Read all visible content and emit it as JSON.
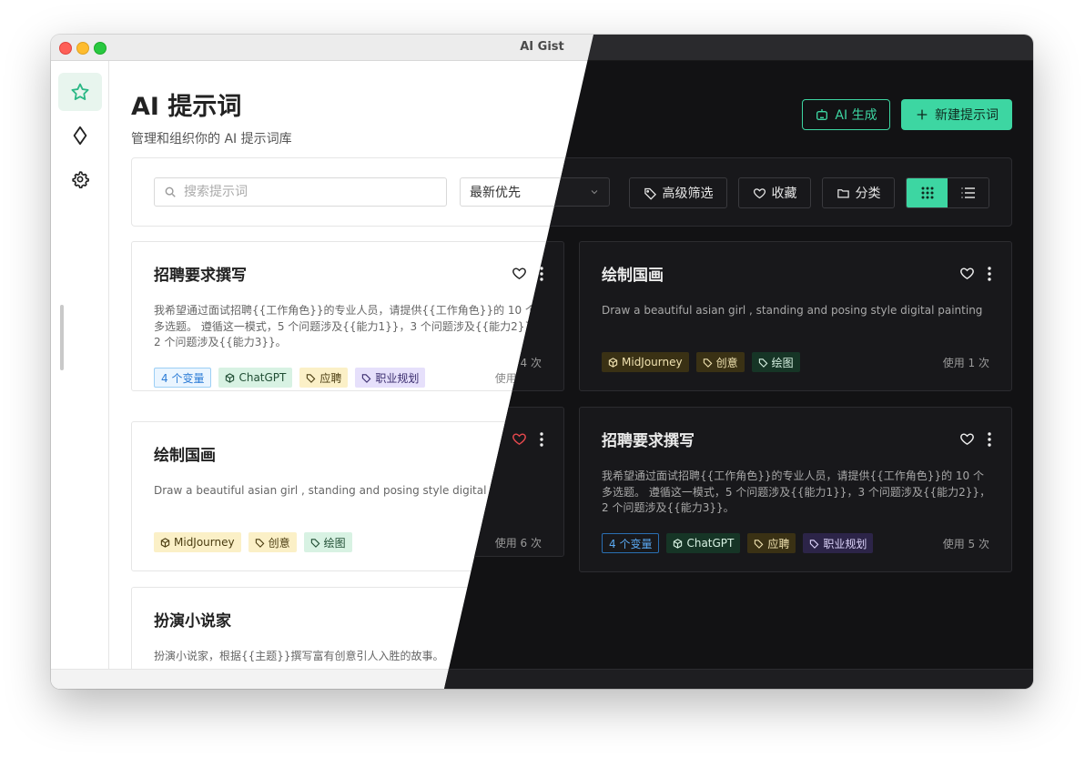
{
  "window": {
    "title": "AI Gist"
  },
  "sidebar": {
    "items": [
      {
        "icon": "star-icon",
        "active": true
      },
      {
        "icon": "diamond-icon",
        "active": false
      },
      {
        "icon": "gear-icon",
        "active": false
      }
    ]
  },
  "header": {
    "title": "AI 提示词",
    "subtitle": "管理和组织你的 AI 提示词库",
    "ai_button": "AI 生成",
    "new_button": "新建提示词"
  },
  "toolbar": {
    "search_placeholder": "搜索提示词",
    "sort_value": "最新优先",
    "filter_label": "高级筛选",
    "favorite_label": "收藏",
    "category_label": "分类"
  },
  "colors": {
    "accent": "#3dd6a2",
    "dark_bg": "#121214",
    "heart_active": "#e5484d"
  },
  "light_cards": [
    {
      "title": "招聘要求撰写",
      "desc": "我希望通过面试招聘{{工作角色}}的专业人员，请提供{{工作角色}}的 10 个多选题。 遵循这一模式，5 个问题涉及{{能力1}}，3 个问题涉及{{能力2}}，2 个问题涉及{{能力3}}。",
      "tags": [
        "4 个变量",
        "ChatGPT",
        "应聘",
        "职业规划"
      ],
      "usage": "使用 4 次"
    },
    {
      "title": "绘制国画",
      "desc": "Draw a beautiful asian girl , standing and posing style digital painting",
      "tags": [
        "MidJourney",
        "创意",
        "绘图"
      ],
      "usage": "使用 6 次"
    },
    {
      "title": "扮演小说家",
      "desc": "扮演小说家，根据{{主题}}撰写富有创意引人入胜的故事。"
    }
  ],
  "dark_cards": [
    {
      "title": "绘制国画",
      "desc": "Draw a beautiful asian girl , standing and posing style digital painting",
      "tags": [
        "MidJourney",
        "创意",
        "绘图"
      ],
      "usage": "使用 1 次"
    },
    {
      "title": "招聘要求撰写",
      "desc": "我希望通过面试招聘{{工作角色}}的专业人员，请提供{{工作角色}}的 10 个多选题。 遵循这一模式，5 个问题涉及{{能力1}}，3 个问题涉及{{能力2}}，2 个问题涉及{{能力3}}。",
      "tags": [
        "4 个变量",
        "ChatGPT",
        "应聘",
        "职业规划"
      ],
      "usage": "使用 5 次"
    }
  ]
}
